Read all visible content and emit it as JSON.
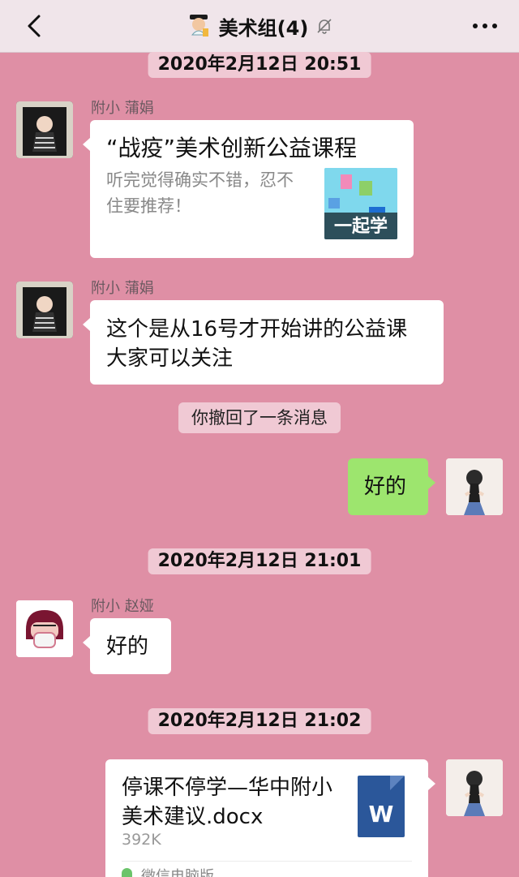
{
  "header": {
    "title": "美术组(4)"
  },
  "timestamps": [
    "2020年2月12日 20:51",
    "2020年2月12日 21:01",
    "2020年2月12日 21:02"
  ],
  "messages": [
    {
      "sender": "附小 蒲娟",
      "title": "“战疫”美术创新公益课程",
      "description": "听完觉得确实不错，忍不住要推荐！",
      "thumb_text": "一起学"
    },
    {
      "sender": "附小 蒲娟",
      "text": "这个是从16号才开始讲的公益课 大家可以关注"
    },
    {
      "system": "你撤回了一条消息"
    },
    {
      "sender": "me",
      "text": "好的"
    },
    {
      "sender": "附小 赵娅",
      "text": "好的"
    },
    {
      "sender": "me",
      "file_name": "停课不停学—华中附小美术建议.docx",
      "file_size": "392K",
      "file_icon": "W",
      "footer": "微信电脑版"
    }
  ],
  "colors": {
    "chat_bg": "#df8fa5",
    "timestamp_bg": "#f0c9d4",
    "bubble": "#ffffff",
    "self_bubble": "#9de56e",
    "word_blue": "#2b579a"
  }
}
